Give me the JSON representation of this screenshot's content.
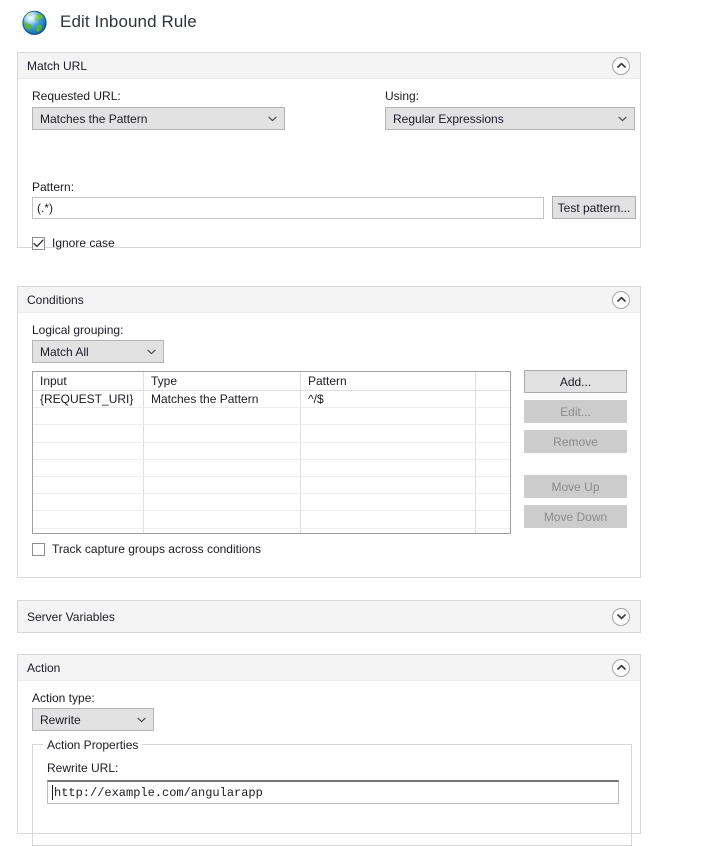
{
  "window": {
    "title": "Edit Inbound Rule",
    "icon": "globe-icon"
  },
  "match_url": {
    "section_title": "Match URL",
    "collapse_icon": "chevron-up-icon",
    "requested_url_label": "Requested URL:",
    "requested_url_value": "Matches the Pattern",
    "using_label": "Using:",
    "using_value": "Regular Expressions",
    "pattern_label": "Pattern:",
    "pattern_value": "(.*)",
    "test_pattern_button": "Test pattern...",
    "ignore_case_label": "Ignore case",
    "ignore_case_checked": true
  },
  "conditions": {
    "section_title": "Conditions",
    "collapse_icon": "chevron-up-icon",
    "logical_grouping_label": "Logical grouping:",
    "logical_grouping_value": "Match All",
    "columns": [
      "Input",
      "Type",
      "Pattern",
      ""
    ],
    "rows": [
      [
        "{REQUEST_URI}",
        "Matches the Pattern",
        "^/$",
        ""
      ]
    ],
    "empty_row_count": 8,
    "buttons": [
      {
        "label": "Add...",
        "enabled": true
      },
      {
        "label": "Edit...",
        "enabled": false
      },
      {
        "label": "Remove",
        "enabled": false
      },
      {
        "label": "Move Up",
        "enabled": false
      },
      {
        "label": "Move Down",
        "enabled": false
      }
    ],
    "track_capture_label": "Track capture groups across conditions",
    "track_capture_checked": false
  },
  "server_variables": {
    "section_title": "Server Variables",
    "collapse_icon": "chevron-down-icon"
  },
  "action": {
    "section_title": "Action",
    "collapse_icon": "chevron-up-icon",
    "action_type_label": "Action type:",
    "action_type_value": "Rewrite",
    "properties_legend": "Action Properties",
    "rewrite_url_label": "Rewrite URL:",
    "rewrite_url_value": "http://example.com/angularapp"
  },
  "colors": {
    "panel_border": "#d8d8d8",
    "panel_header_bg": "#f4f4f4",
    "combo_bg": "#e2e2e2",
    "button_bg": "#e1e1e1",
    "button_disabled_bg": "#cccccc",
    "text": "#1b1b28",
    "title_text": "#2e3440"
  }
}
